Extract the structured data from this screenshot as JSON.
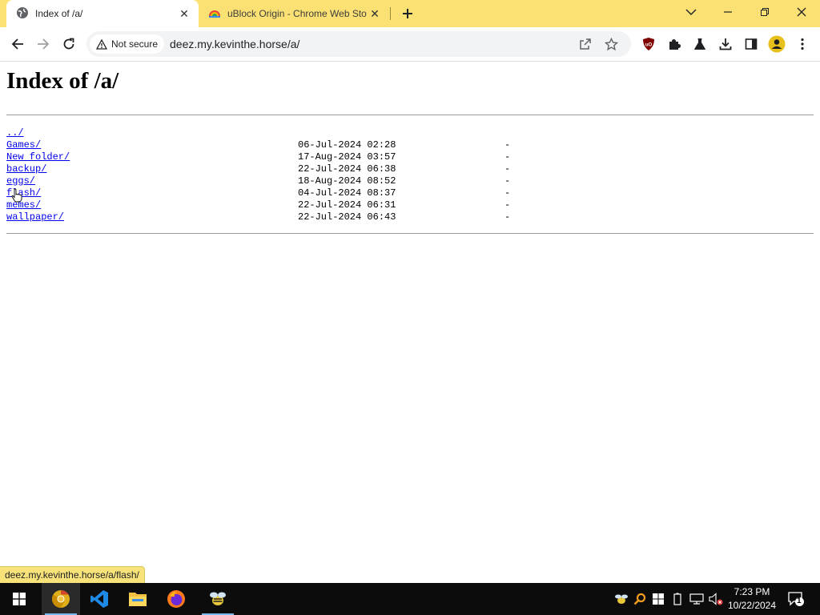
{
  "tabs": [
    {
      "title": "Index of /a/",
      "active": true
    },
    {
      "title": "uBlock Origin - Chrome Web Store",
      "active": false
    }
  ],
  "omnibox": {
    "security_label": "Not secure",
    "url": "deez.my.kevinthe.horse/a/"
  },
  "page": {
    "title": "Index of /a/",
    "parent_link": "../",
    "entries": [
      {
        "name": "Games/",
        "date": "06-Jul-2024 02:28",
        "size": "-"
      },
      {
        "name": "New folder/",
        "date": "17-Aug-2024 03:57",
        "size": "-"
      },
      {
        "name": "backup/",
        "date": "22-Jul-2024 06:38",
        "size": "-"
      },
      {
        "name": "eggs/",
        "date": "18-Aug-2024 08:52",
        "size": "-"
      },
      {
        "name": "flash/",
        "date": "04-Jul-2024 08:37",
        "size": "-"
      },
      {
        "name": "memes/",
        "date": "22-Jul-2024 06:31",
        "size": "-"
      },
      {
        "name": "wallpaper/",
        "date": "22-Jul-2024 06:43",
        "size": "-"
      }
    ]
  },
  "status_url": "deez.my.kevinthe.horse/a/flash/",
  "taskbar": {
    "time": "7:23 PM",
    "date": "10/22/2024",
    "notification_count": "1"
  },
  "colors": {
    "frame": "#fbe174",
    "link": "#0000ee",
    "taskbar": "#0c0c0c"
  }
}
